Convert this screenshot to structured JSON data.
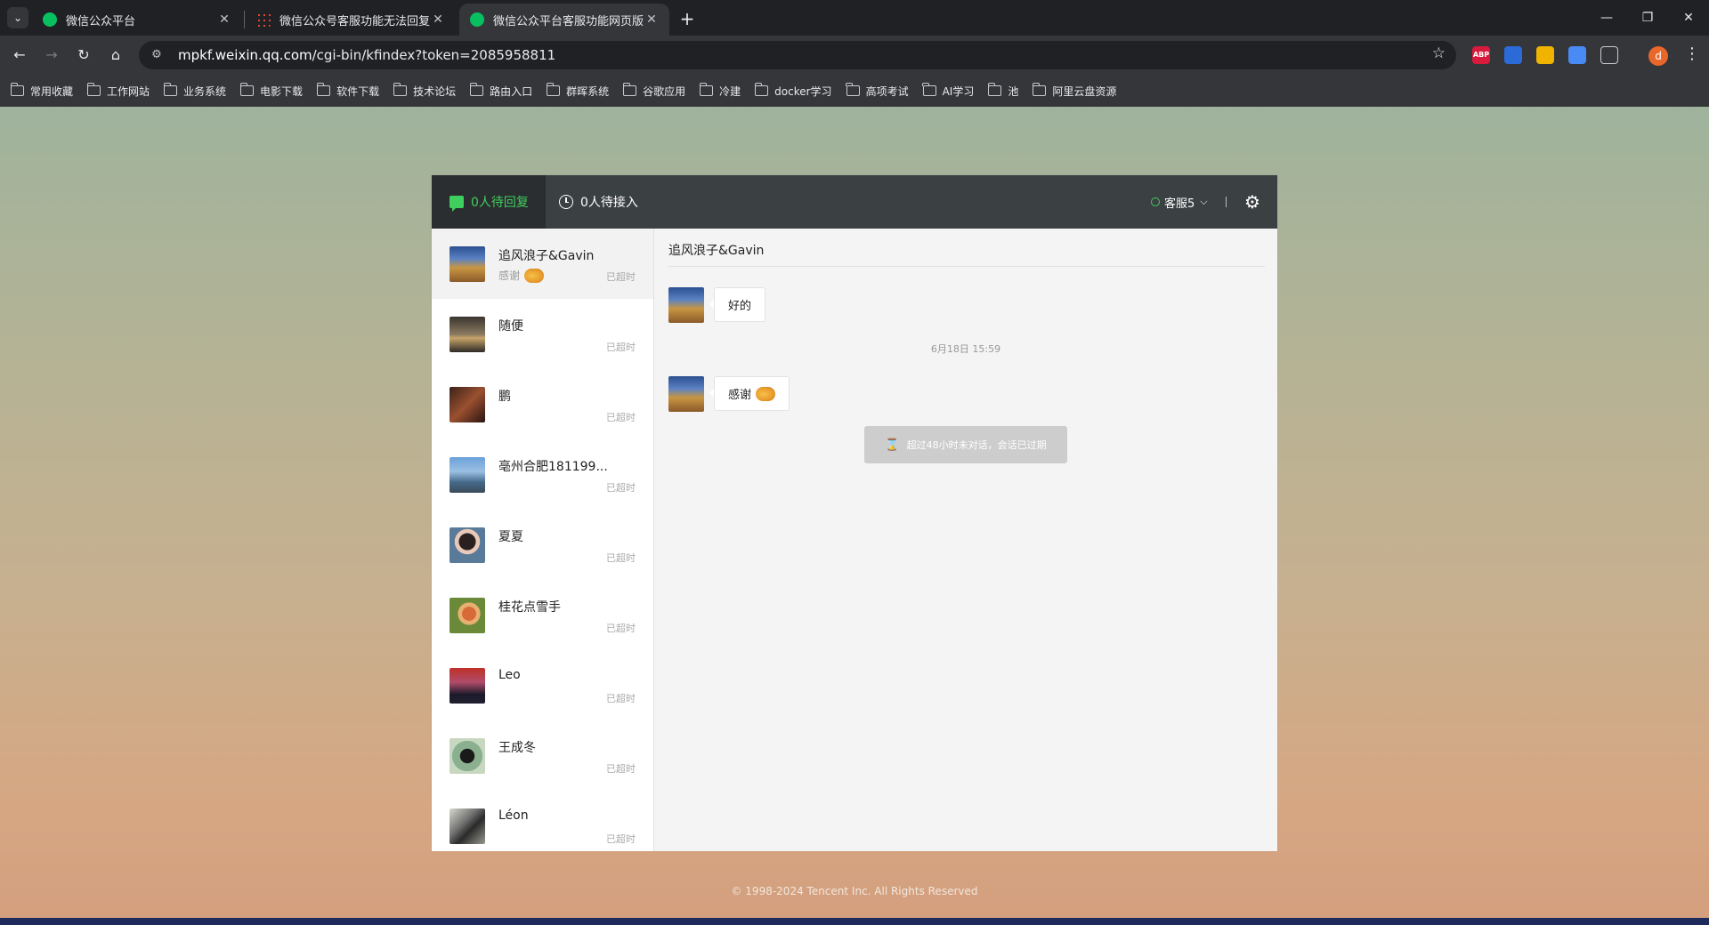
{
  "browser": {
    "tabs": [
      {
        "label": "微信公众平台",
        "icon": "wechat-icon"
      },
      {
        "label": "微信公众号客服功能无法回复消",
        "icon": "grid-icon"
      },
      {
        "label": "微信公众平台客服功能网页版",
        "icon": "wechat-icon"
      }
    ],
    "url_host": "mpkf.weixin.qq.com",
    "url_path": "/cgi-bin/kfindex?token=2085958811",
    "profile_initial": "d",
    "extensions": [
      "ABP",
      "",
      "",
      "",
      ""
    ],
    "bookmarks": [
      "常用收藏",
      "工作网站",
      "业务系统",
      "电影下载",
      "软件下载",
      "技术论坛",
      "路由入口",
      "群晖系统",
      "谷歌应用",
      "冷建",
      "docker学习",
      "高项考试",
      "AI学习",
      "池",
      "阿里云盘资源"
    ]
  },
  "header": {
    "tab_waiting_reply": "0人待回复",
    "tab_waiting_accept": "0人待接入",
    "agent_name": "客服5",
    "divider": "|"
  },
  "sessions": [
    {
      "name": "追风浪子&Gavin",
      "preview": "感谢",
      "status": "已超时"
    },
    {
      "name": "随便",
      "preview": "",
      "status": "已超时"
    },
    {
      "name": "鹏",
      "preview": "",
      "status": "已超时"
    },
    {
      "name": "亳州合肥181199...",
      "preview": "",
      "status": "已超时"
    },
    {
      "name": "夏夏",
      "preview": "",
      "status": "已超时"
    },
    {
      "name": "桂花点雪手",
      "preview": "",
      "status": "已超时"
    },
    {
      "name": "Leo",
      "preview": "",
      "status": "已超时"
    },
    {
      "name": "王成冬",
      "preview": "",
      "status": "已超时"
    },
    {
      "name": "Léon",
      "preview": "",
      "status": "已超时"
    }
  ],
  "chat": {
    "title": "追风浪子&Gavin",
    "messages": [
      {
        "text": "好的"
      },
      {
        "text": "感谢"
      }
    ],
    "timestamp": "6月18日 15:59",
    "expired_notice": "超过48小时未对话，会话已过期"
  },
  "footer": "© 1998-2024 Tencent Inc. All Rights Reserved",
  "colors": {
    "accent_green": "#3fcf5e",
    "header_bg": "#3b4042"
  }
}
